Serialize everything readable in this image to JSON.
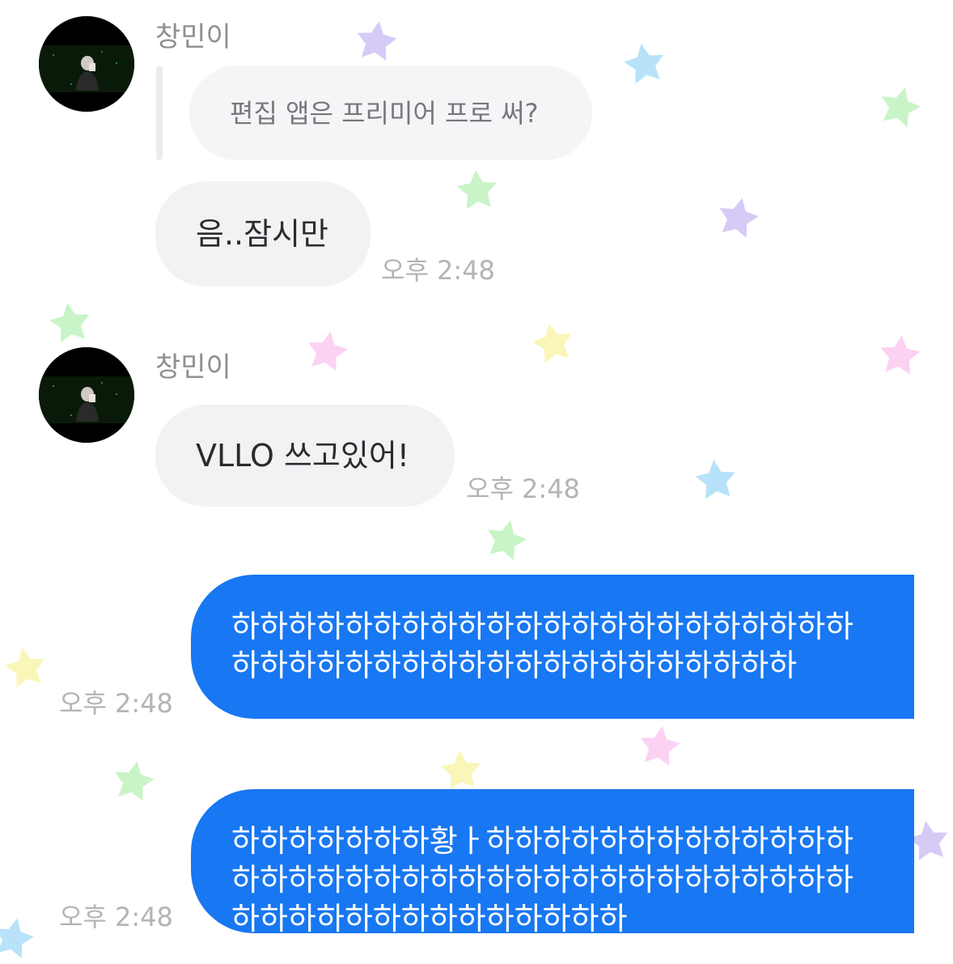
{
  "theme": {
    "outgoing_bubble": "#1877f2",
    "incoming_bubble": "#f2f2f5",
    "reply_bubble": "#f5f5f7",
    "timestamp_color": "#b3b3b8",
    "name_color": "#8e8e93",
    "background_stars": [
      "#c9b8f5",
      "#9fd8f7",
      "#b7f0b4",
      "#f9f3a0",
      "#fbc2ee"
    ]
  },
  "messages": [
    {
      "group": 1,
      "sender": "창민이",
      "reply_quote": "편집 앱은 프리미어 프로 써?",
      "text": "음..잠시만",
      "time": "오후 2:48"
    },
    {
      "group": 2,
      "sender": "창민이",
      "text": "VLLO 쓰고있어!",
      "time": "오후 2:48"
    },
    {
      "group": 3,
      "sender": "me",
      "text": "하하하하하하하하하하하하하하하하하하하하하하하하하하하하하하하하하하하하하하하하하하",
      "time": "오후 2:48"
    },
    {
      "group": 4,
      "sender": "me",
      "text": "하하하하하하하황ㅏ하하하하하하하하하하하하하하하하하하하하하하하하하하하하하하하하하하하하하하하하하하하하하하하하하",
      "time": "오후 2:48"
    }
  ]
}
